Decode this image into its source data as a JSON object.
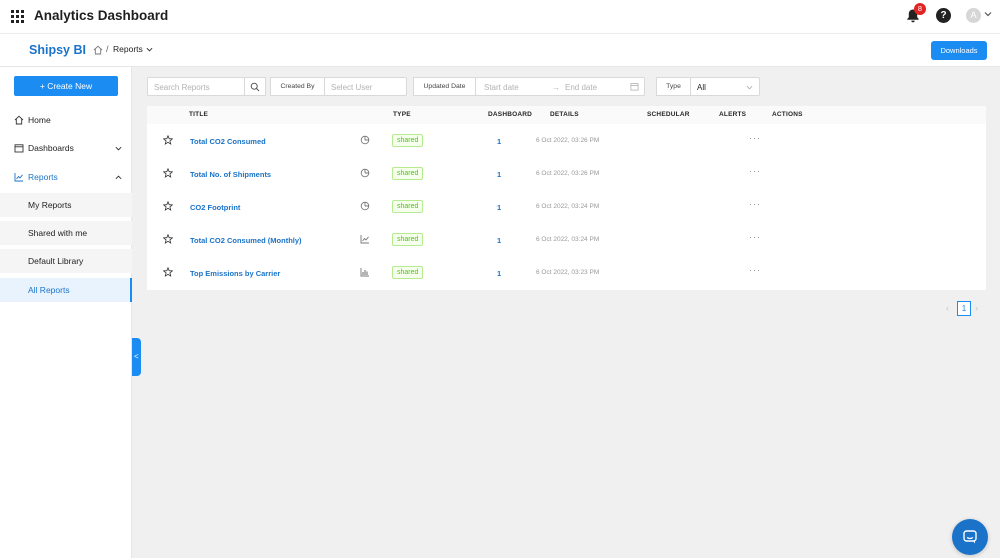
{
  "header": {
    "app_title": "Analytics Dashboard",
    "notification_count": "8",
    "help_label": "?",
    "avatar_initial": "A"
  },
  "subheader": {
    "brand": "Shipsy BI",
    "breadcrumb_sep": "/",
    "breadcrumb_current": "Reports",
    "downloads_label": "Downloads"
  },
  "sidebar": {
    "create_label": "+ Create New",
    "items": [
      {
        "label": "Home"
      },
      {
        "label": "Dashboards"
      },
      {
        "label": "Reports"
      }
    ],
    "sub_items": [
      {
        "label": "My Reports"
      },
      {
        "label": "Shared with me"
      },
      {
        "label": "Default Library"
      },
      {
        "label": "All Reports"
      }
    ]
  },
  "filters": {
    "search_placeholder": "Search Reports",
    "created_by_label": "Created By",
    "select_user_placeholder": "Select User",
    "updated_date_label": "Updated Date",
    "start_date_placeholder": "Start date",
    "date_arrow": "→",
    "end_date_placeholder": "End date",
    "type_label": "Type",
    "type_value": "All"
  },
  "table": {
    "columns": [
      "TITLE",
      "TYPE",
      "DASHBOARD",
      "DETAILS",
      "SCHEDULAR",
      "ALERTS",
      "ACTIONS"
    ],
    "rows": [
      {
        "title": "Total CO2 Consumed",
        "type": "shared",
        "dashboard": "1",
        "details": "6 Oct 2022, 03:26 PM",
        "actions": "···"
      },
      {
        "title": "Total No. of Shipments",
        "type": "shared",
        "dashboard": "1",
        "details": "6 Oct 2022, 03:26 PM",
        "actions": "···"
      },
      {
        "title": "CO2 Footprint",
        "type": "shared",
        "dashboard": "1",
        "details": "6 Oct 2022, 03:24 PM",
        "actions": "···"
      },
      {
        "title": "Total CO2 Consumed (Monthly)",
        "type": "shared",
        "dashboard": "1",
        "details": "6 Oct 2022, 03:24 PM",
        "actions": "···"
      },
      {
        "title": "Top Emissions by Carrier",
        "type": "shared",
        "dashboard": "1",
        "details": "6 Oct 2022, 03:23 PM",
        "actions": "···"
      }
    ]
  },
  "pagination": {
    "prev": "‹",
    "current": "1",
    "next": "›"
  },
  "colors": {
    "accent": "#1a8cf2",
    "link": "#1a73c9",
    "shared_badge": "#52c41a"
  }
}
